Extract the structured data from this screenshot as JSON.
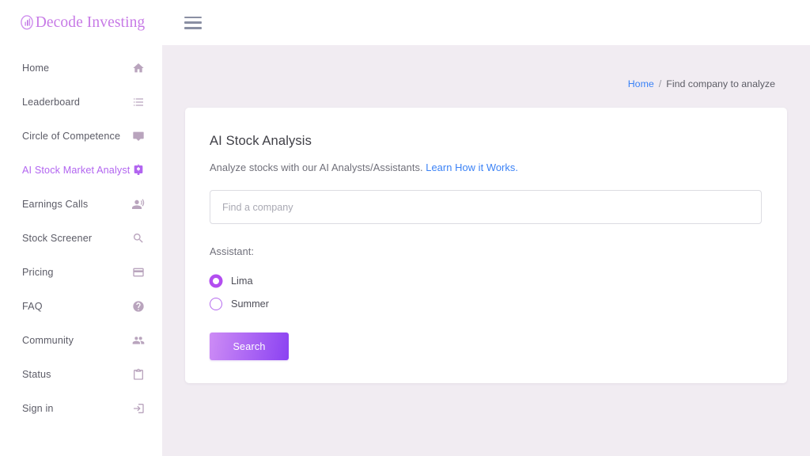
{
  "brand": {
    "name": "Decode Investing",
    "logo_color": "#c77ae6"
  },
  "sidebar": {
    "items": [
      {
        "label": "Home",
        "icon": "home-icon",
        "active": false
      },
      {
        "label": "Leaderboard",
        "icon": "list-icon",
        "active": false
      },
      {
        "label": "Circle of Competence",
        "icon": "chat-box-icon",
        "active": false
      },
      {
        "label": "AI Stock Market Analyst",
        "icon": "ai-assistant-icon",
        "active": true
      },
      {
        "label": "Earnings Calls",
        "icon": "record-voice-icon",
        "active": false
      },
      {
        "label": "Stock Screener",
        "icon": "search-icon",
        "active": false
      },
      {
        "label": "Pricing",
        "icon": "credit-card-icon",
        "active": false
      },
      {
        "label": "FAQ",
        "icon": "help-circle-icon",
        "active": false
      },
      {
        "label": "Community",
        "icon": "people-icon",
        "active": false
      },
      {
        "label": "Status",
        "icon": "clipboard-icon",
        "active": false
      },
      {
        "label": "Sign in",
        "icon": "login-icon",
        "active": false
      }
    ]
  },
  "topbar": {
    "menu_icon": "hamburger-menu-icon"
  },
  "breadcrumb": {
    "home_label": "Home",
    "separator": "/",
    "current_label": "Find company to analyze"
  },
  "card": {
    "title": "AI Stock Analysis",
    "subtitle_text": "Analyze stocks with our AI Analysts/Assistants.",
    "subtitle_link": "Learn How it Works.",
    "search": {
      "placeholder": "Find a company",
      "value": ""
    },
    "assistant": {
      "label": "Assistant:",
      "options": [
        {
          "label": "Lima",
          "selected": true
        },
        {
          "label": "Summer",
          "selected": false
        }
      ]
    },
    "submit_label": "Search"
  },
  "colors": {
    "accent": "#b265f0",
    "link": "#3b82f6",
    "page_bg": "#f1ecf2",
    "card_bg": "#ffffff"
  }
}
